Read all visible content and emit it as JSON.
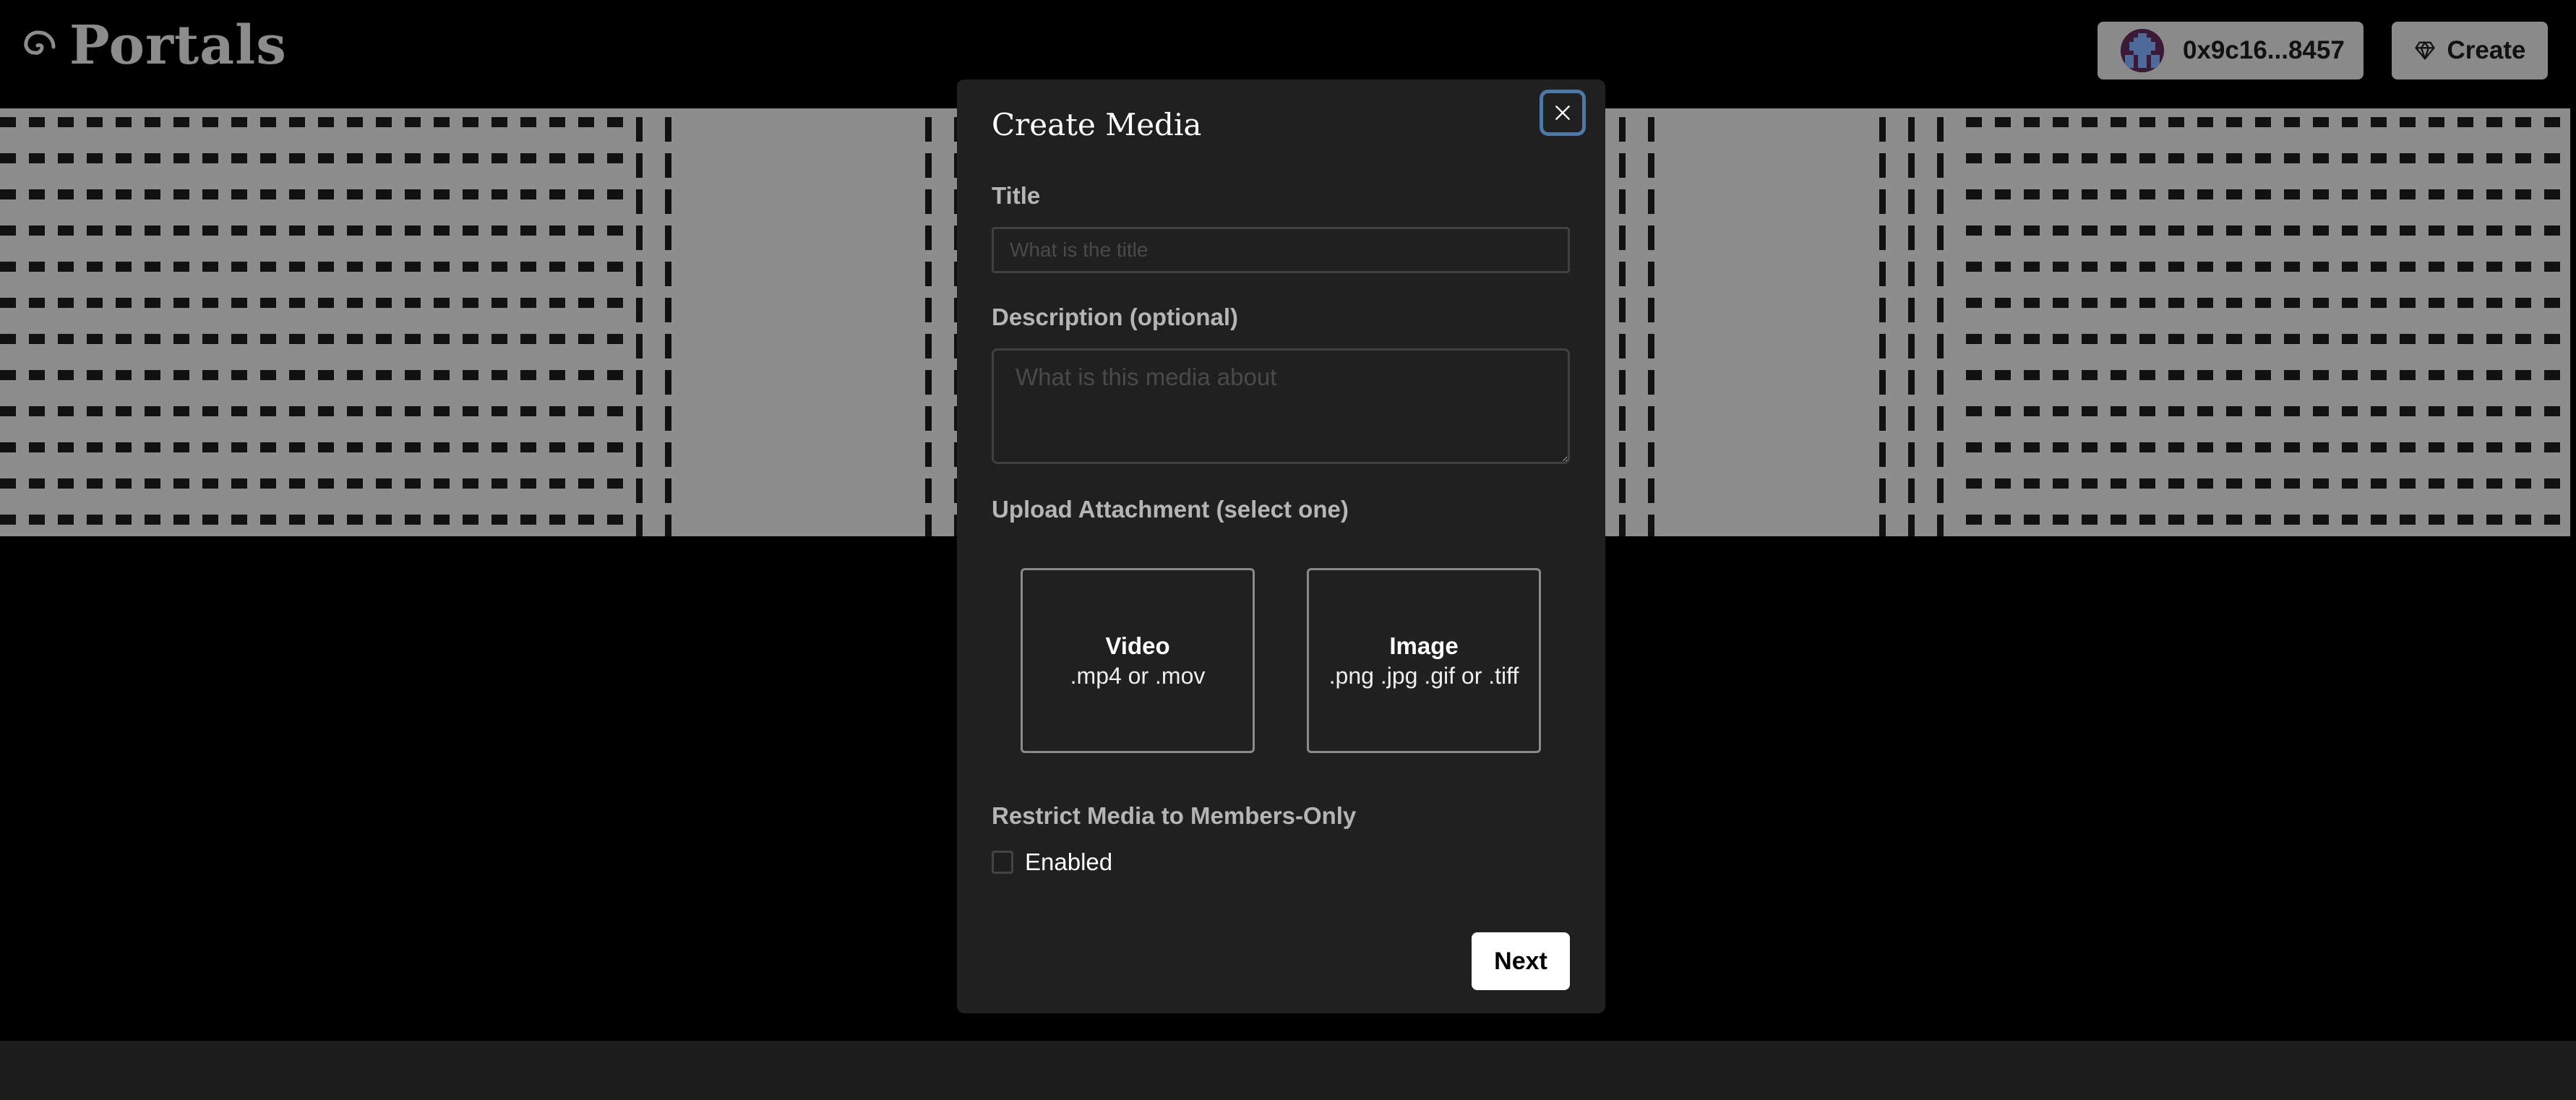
{
  "header": {
    "logo_text": "Portals",
    "logo_icon": "spiral-icon",
    "account_button": {
      "label": "0x9c16...8457",
      "icon": "pixel-avatar"
    },
    "create_button": {
      "label": "Create",
      "icon": "diamond-icon"
    }
  },
  "banner": {
    "description": "grayscale distorted pattern banner image"
  },
  "modal": {
    "title": "Create Media",
    "close_icon": "close-icon",
    "title_field": {
      "label": "Title",
      "value": "",
      "placeholder": "What is the title"
    },
    "description_field": {
      "label": "Description (optional)",
      "value": "",
      "placeholder": "What is this media about"
    },
    "upload": {
      "label": "Upload Attachment (select one)",
      "options": [
        {
          "title": "Video",
          "formats": ".mp4 or .mov"
        },
        {
          "title": "Image",
          "formats": ".png .jpg .gif or .tiff"
        }
      ]
    },
    "restrict": {
      "label": "Restrict Media to Members-Only",
      "checkbox_label": "Enabled",
      "checked": false
    },
    "next_label": "Next"
  },
  "colors": {
    "background": "#000000",
    "modal_bg": "#202020",
    "header_button_bg": "#8a8a8a",
    "focus_ring": "#4d79a8",
    "primary_button_bg": "#ffffff"
  }
}
